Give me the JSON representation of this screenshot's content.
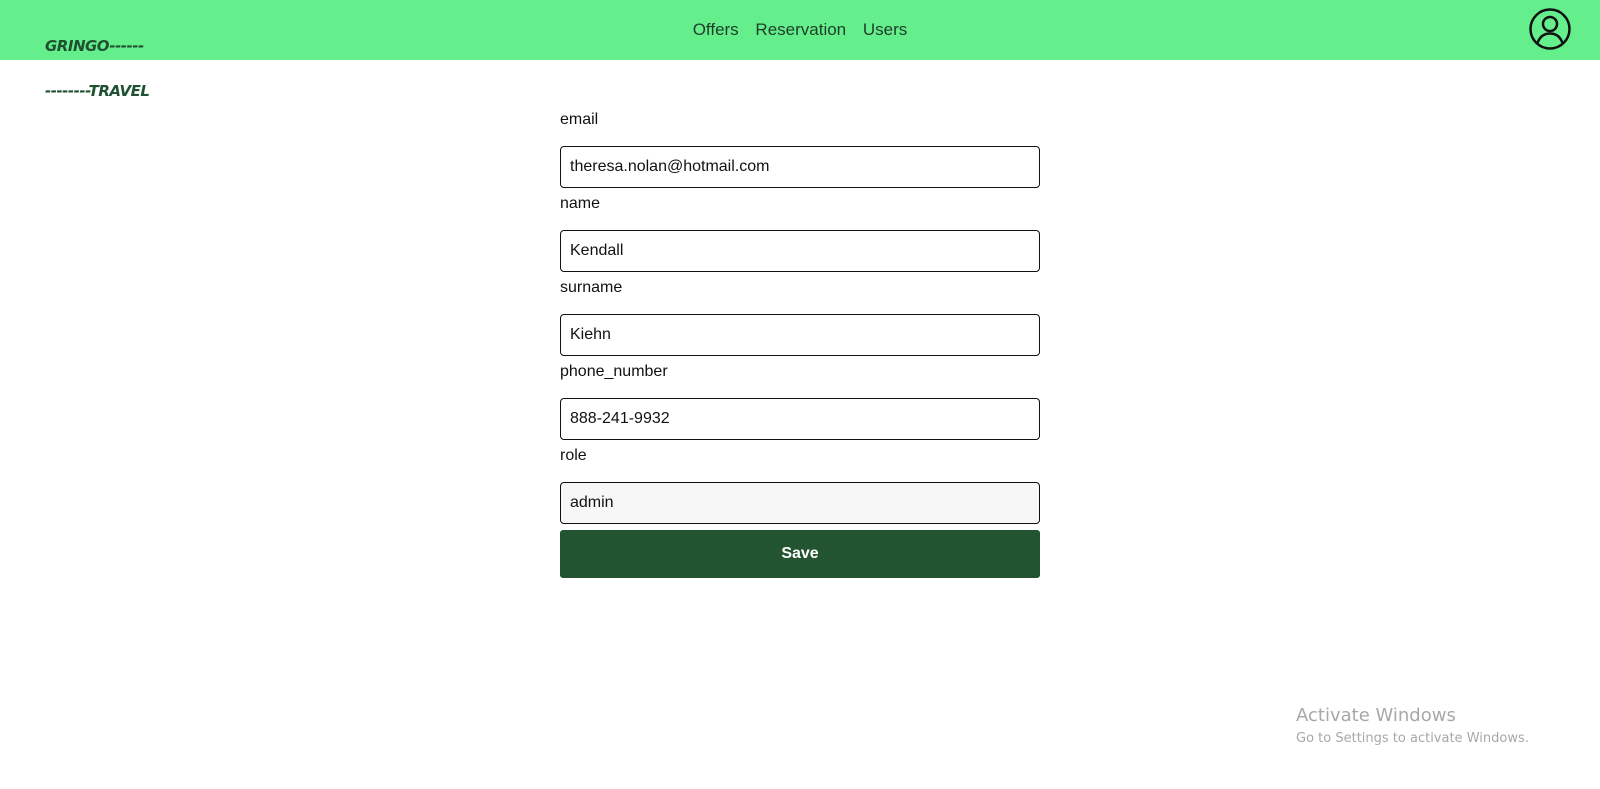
{
  "header": {
    "logo_line1": "GRINGO------",
    "logo_line2": "--------TRAVEL",
    "nav": [
      {
        "label": "Offers"
      },
      {
        "label": "Reservation"
      },
      {
        "label": "Users"
      }
    ],
    "avatar_icon": "user-circle-icon",
    "background_color": "#64ef8c"
  },
  "form": {
    "fields": [
      {
        "label": "email",
        "value": "theresa.nolan@hotmail.com"
      },
      {
        "label": "name",
        "value": "Kendall"
      },
      {
        "label": "surname",
        "value": "Kiehn"
      },
      {
        "label": "phone_number",
        "value": "888-241-9932"
      },
      {
        "label": "role",
        "value": "admin"
      }
    ],
    "save_label": "Save",
    "save_color": "#235432"
  },
  "watermark": {
    "title": "Activate Windows",
    "subtitle": "Go to Settings to activate Windows."
  }
}
